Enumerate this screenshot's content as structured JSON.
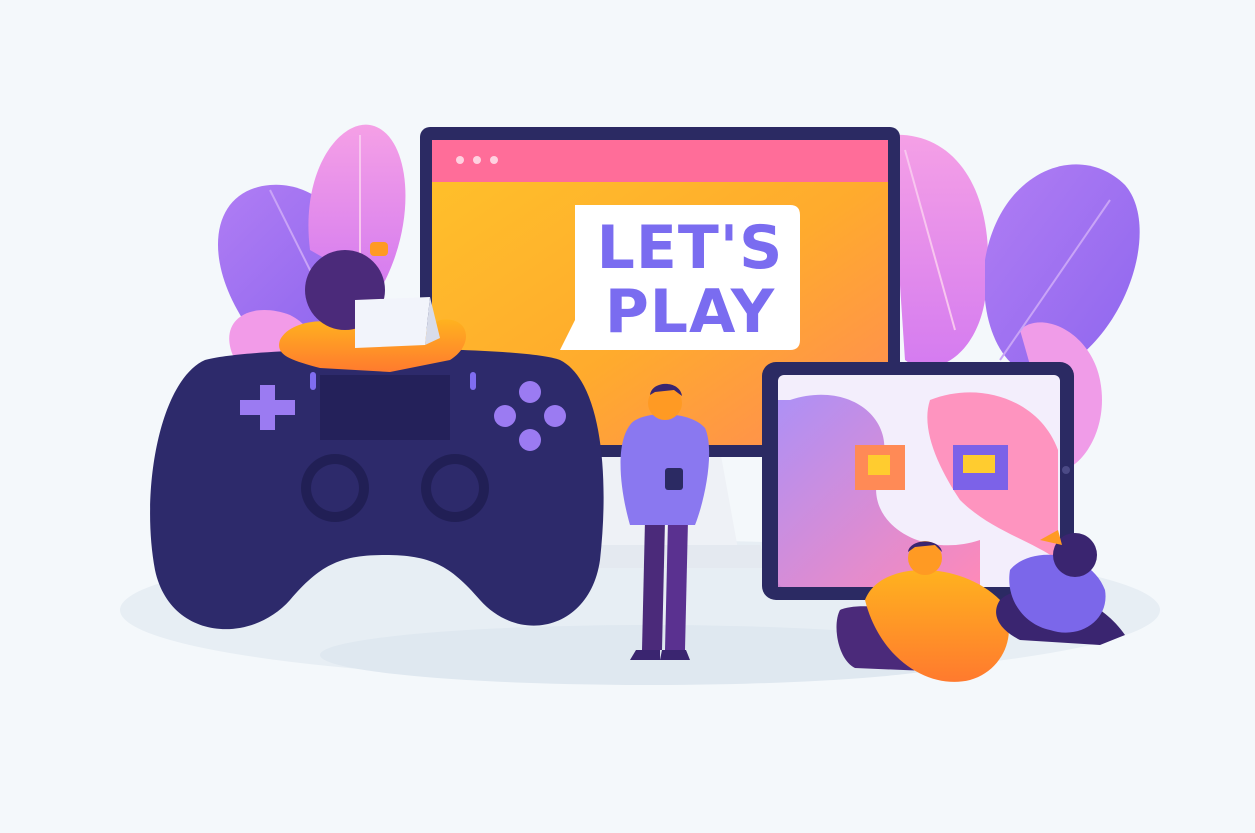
{
  "scene": {
    "speech_bubble": {
      "line1": "LET'S",
      "line2": "PLAY"
    }
  },
  "colors": {
    "background": "#f4f8fb",
    "controller": "#2d2a6b",
    "controller_dark": "#211f55",
    "button_purple": "#9b7bf2",
    "monitor_frame": "#2b2a63",
    "screen_orange": "#ffb12b",
    "screen_pink_bar": "#ff6d99",
    "speech_text": "#7a6cf0",
    "leaf_pink": "#ee8dea",
    "leaf_violet": "#9d6bf0",
    "tablet_frame": "#2b2a63",
    "person_orange": "#ff9a23",
    "person_purple": "#4b2a7a"
  },
  "icons": [
    "gamepad-icon",
    "monitor-icon",
    "tablet-icon",
    "speech-bubble-icon"
  ]
}
